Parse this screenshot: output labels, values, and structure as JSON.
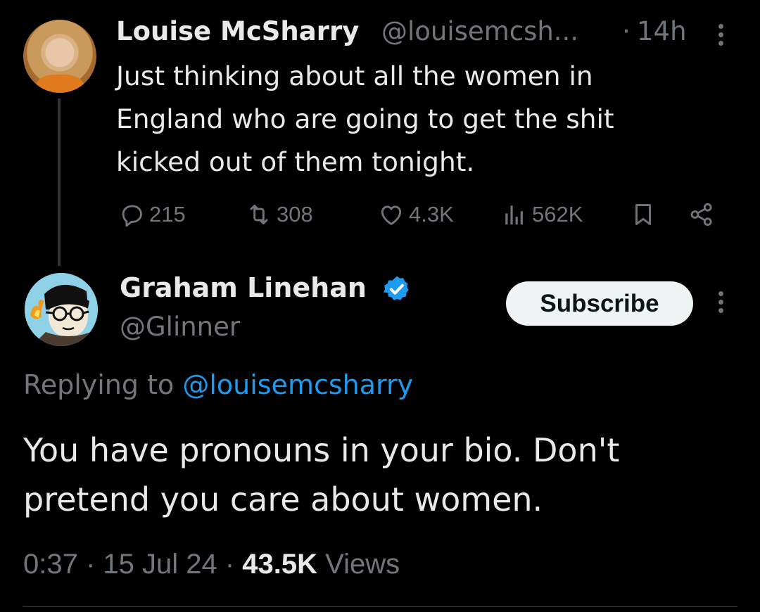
{
  "parent_tweet": {
    "display_name": "Louise McSharry",
    "handle": "@louisemcsh...",
    "separator": "·",
    "time": "14h",
    "text": "Just thinking about all the women in England who are going to get the shit kicked out of them tonight.",
    "stats": {
      "replies": "215",
      "reposts": "308",
      "likes": "4.3K",
      "views": "562K"
    }
  },
  "reply_tweet": {
    "display_name": "Graham Linehan",
    "handle": "@Glinner",
    "subscribe_label": "Subscribe",
    "replying_prefix": "Replying to ",
    "replying_to": "@louisemcsharry",
    "text": "You have pronouns in your bio. Don't pretend you care about women.",
    "meta": {
      "time": "0:37",
      "date": "15 Jul 24",
      "views_count": "43.5K",
      "views_label": "Views",
      "separator": " · "
    }
  },
  "icons": [
    "reply-icon",
    "repost-icon",
    "like-icon",
    "views-icon",
    "bookmark-icon",
    "share-icon",
    "verified-badge-icon",
    "more-icon"
  ],
  "colors": {
    "background": "#000000",
    "primary_text": "#e7e9ea",
    "secondary_text": "#71767b",
    "link": "#1d9bf0",
    "verified": "#1d9bf0"
  }
}
